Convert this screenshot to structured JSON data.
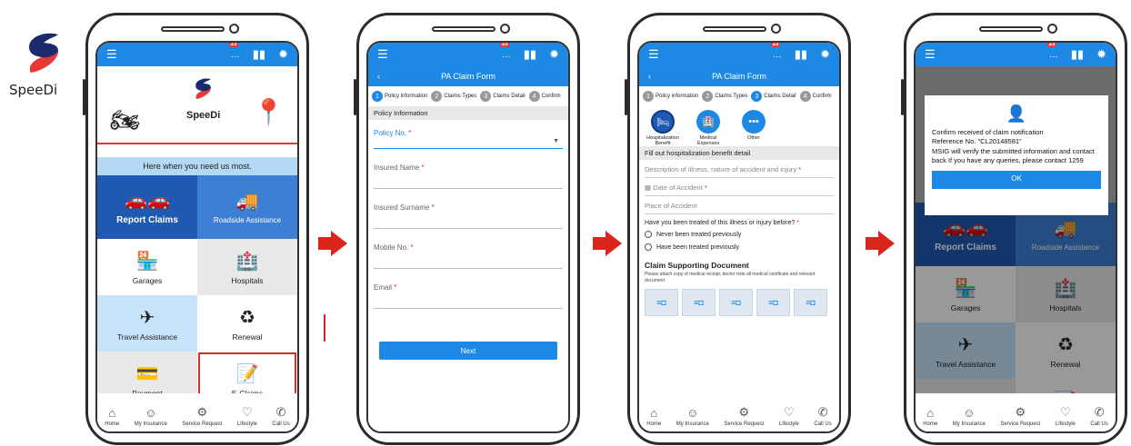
{
  "brand": {
    "name": "SpeeDi"
  },
  "common": {
    "badge_count": "23",
    "nav": [
      {
        "icon": "home-icon",
        "label": "Home"
      },
      {
        "icon": "insurance-icon",
        "label": "My Insurance"
      },
      {
        "icon": "service-icon",
        "label": "Service Request"
      },
      {
        "icon": "lifestyle-icon",
        "label": "Lifestyle"
      },
      {
        "icon": "phone-icon",
        "label": "Call Us"
      }
    ]
  },
  "screen1": {
    "logo_text": "SpeeDi",
    "tagline": "Here when you need us most.",
    "tiles": {
      "report": "Report Claims",
      "roadside": "Roadside Assistance",
      "garages": "Garages",
      "hospitals": "Hospitals",
      "travel": "Travel Assistance",
      "renewal": "Renewal",
      "payment": "Payment",
      "eclaims": "E-Claims"
    }
  },
  "form": {
    "title": "PA Claim Form",
    "steps": [
      {
        "n": "1",
        "label": "Policy information"
      },
      {
        "n": "2",
        "label": "Claims Types"
      },
      {
        "n": "3",
        "label": "Claims Detail"
      },
      {
        "n": "4",
        "label": "Confirm"
      }
    ]
  },
  "screen2": {
    "section": "Policy Information",
    "fields": {
      "policy": "Policy No.",
      "name": "Insured Name",
      "surname": "Insured Surname",
      "mobile": "Mobile No.",
      "email": "Email"
    },
    "next": "Next"
  },
  "screen3": {
    "types": {
      "hospitalization": "Hospitalization Benefit",
      "medical": "Medical Expenses",
      "other": "Other"
    },
    "section": "Fill out hospitalization benefit detail",
    "description": "Description of illness, nature of accident and injury",
    "date": "Date of Accident",
    "place": "Place of Accident",
    "question": "Have you been treated of this illness or injury before?",
    "opt1": "Never been treated previously",
    "opt2": "Have been treated previously",
    "csd_title": "Claim Supporting Document",
    "csd_note": "Please attach copy of medical receipt, doctor note all medical certificate and relevant document"
  },
  "screen4": {
    "line1": "Confirm received of claim notification",
    "line2": "Reference No. \"CL20148581\"",
    "line3": "MSIG will verify the submitted information and contact back If you have any queries, please contact 1259",
    "ok": "OK"
  },
  "colors": {
    "accent": "#1e88e5",
    "dark_tile": "#1e5ab3",
    "arrow": "#d8261c"
  }
}
